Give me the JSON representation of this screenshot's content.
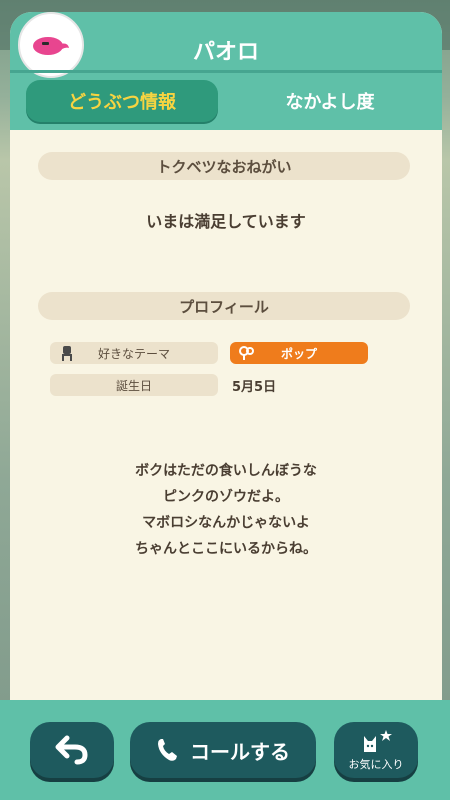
{
  "villager": {
    "name": "パオロ"
  },
  "tabs": [
    {
      "label": "どうぶつ情報",
      "active": true
    },
    {
      "label": "なかよし度",
      "active": false
    }
  ],
  "request": {
    "header": "トクベツなおねがい",
    "message": "いまは満足しています"
  },
  "profile": {
    "header": "プロフィール",
    "favorite_theme": {
      "label": "好きなテーマ",
      "value": "ポップ"
    },
    "birthday": {
      "label": "誕生日",
      "value": "5月5日"
    }
  },
  "quote_lines": [
    "ボクはただの食いしんぼうな",
    "ピンクのゾウだよ。",
    "マボロシなんかじゃないよ",
    "ちゃんとここにいるからね。"
  ],
  "buttons": {
    "back_icon": "back-arrow-icon",
    "call": "コールする",
    "favorite": "お気に入り"
  },
  "colors": {
    "header": "#5fc0a8",
    "active_tab": "#2f9a7c",
    "active_tab_text": "#f7d441",
    "theme_badge": "#ef7c1c",
    "button": "#1e5a5e",
    "panel": "#f9f5e4"
  }
}
